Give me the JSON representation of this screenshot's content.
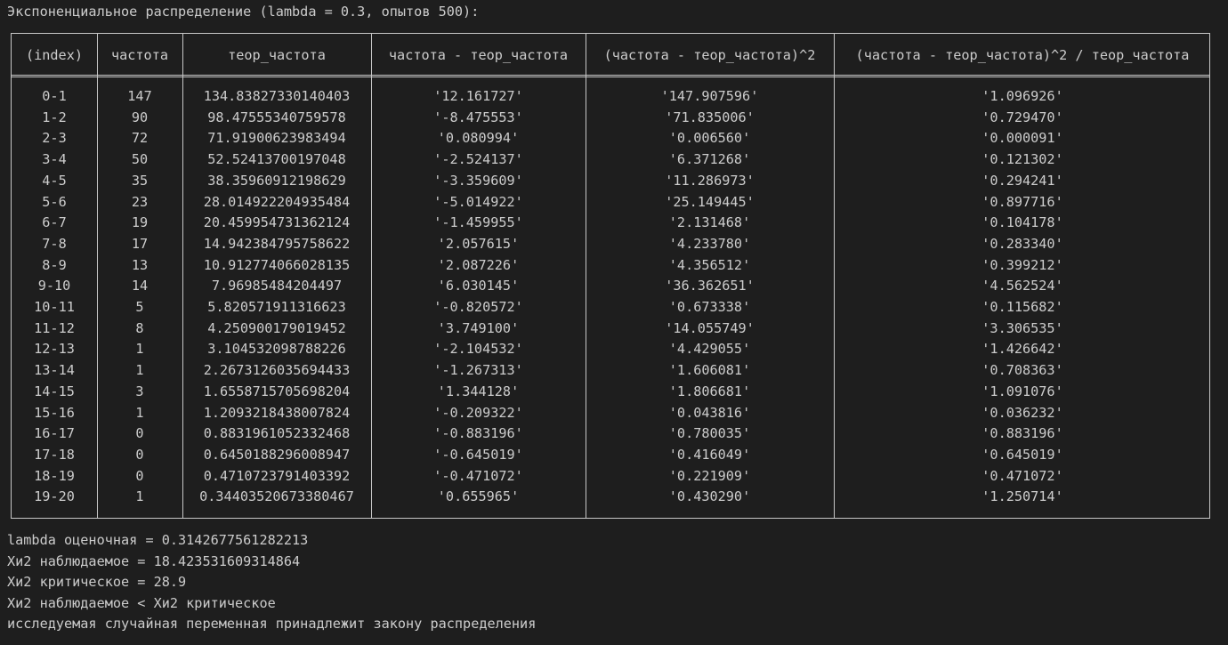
{
  "title_line": "Экспоненциальное распределение (lambda = 0.3, опытов 500):",
  "table": {
    "headers": [
      "(index)",
      "частота",
      "теор_частота",
      "частота - теор_частота",
      "(частота - теор_частота)^2",
      "(частота - теор_частота)^2 / теор_частота"
    ],
    "rows": [
      [
        "0-1",
        "147",
        "134.83827330140403",
        "'12.161727'",
        "'147.907596'",
        "'1.096926'"
      ],
      [
        "1-2",
        "90",
        "98.47555340759578",
        "'-8.475553'",
        "'71.835006'",
        "'0.729470'"
      ],
      [
        "2-3",
        "72",
        "71.91900623983494",
        "'0.080994'",
        "'0.006560'",
        "'0.000091'"
      ],
      [
        "3-4",
        "50",
        "52.52413700197048",
        "'-2.524137'",
        "'6.371268'",
        "'0.121302'"
      ],
      [
        "4-5",
        "35",
        "38.35960912198629",
        "'-3.359609'",
        "'11.286973'",
        "'0.294241'"
      ],
      [
        "5-6",
        "23",
        "28.014922204935484",
        "'-5.014922'",
        "'25.149445'",
        "'0.897716'"
      ],
      [
        "6-7",
        "19",
        "20.459954731362124",
        "'-1.459955'",
        "'2.131468'",
        "'0.104178'"
      ],
      [
        "7-8",
        "17",
        "14.942384795758622",
        "'2.057615'",
        "'4.233780'",
        "'0.283340'"
      ],
      [
        "8-9",
        "13",
        "10.912774066028135",
        "'2.087226'",
        "'4.356512'",
        "'0.399212'"
      ],
      [
        "9-10",
        "14",
        "7.96985484204497",
        "'6.030145'",
        "'36.362651'",
        "'4.562524'"
      ],
      [
        "10-11",
        "5",
        "5.820571911316623",
        "'-0.820572'",
        "'0.673338'",
        "'0.115682'"
      ],
      [
        "11-12",
        "8",
        "4.250900179019452",
        "'3.749100'",
        "'14.055749'",
        "'3.306535'"
      ],
      [
        "12-13",
        "1",
        "3.10453209878822 6",
        "'-2.104532'",
        "'4.429055'",
        "'1.426642'"
      ],
      [
        "13-14",
        "1",
        "2.2673126035694433",
        "'-1.267313'",
        "'1.606081'",
        "'0.708363'"
      ],
      [
        "14-15",
        "3",
        "1.6558715705698204",
        "'1.344128'",
        "'1.806681'",
        "'1.091076'"
      ],
      [
        "15-16",
        "1",
        "1.2093218438007824",
        "'-0.209322'",
        "'0.043816'",
        "'0.036232'"
      ],
      [
        "16-17",
        "0",
        "0.8831961052332468",
        "'-0.883196'",
        "'0.780035'",
        "'0.883196'"
      ],
      [
        "17-18",
        "0",
        "0.6450188296008947",
        "'-0.645019'",
        "'0.416049'",
        "'0.645019'"
      ],
      [
        "18-19",
        "0",
        "0.4710723791403392",
        "'-0.471072'",
        "'0.221909'",
        "'0.471072'"
      ],
      [
        "19-20",
        "1",
        "0.34403520673380467",
        "'0.655965'",
        "'0.430290'",
        "'1.250714'"
      ]
    ]
  },
  "footer": [
    "lambda оценочная = 0.3142677561282213",
    "Хи2 наблюдаемое = 18.423531609314864",
    "Хи2 критическое = 28.9",
    "Хи2 наблюдаемое < Хи2 критическое",
    "исследуемая случайная переменная принадлежит закону распределения"
  ]
}
